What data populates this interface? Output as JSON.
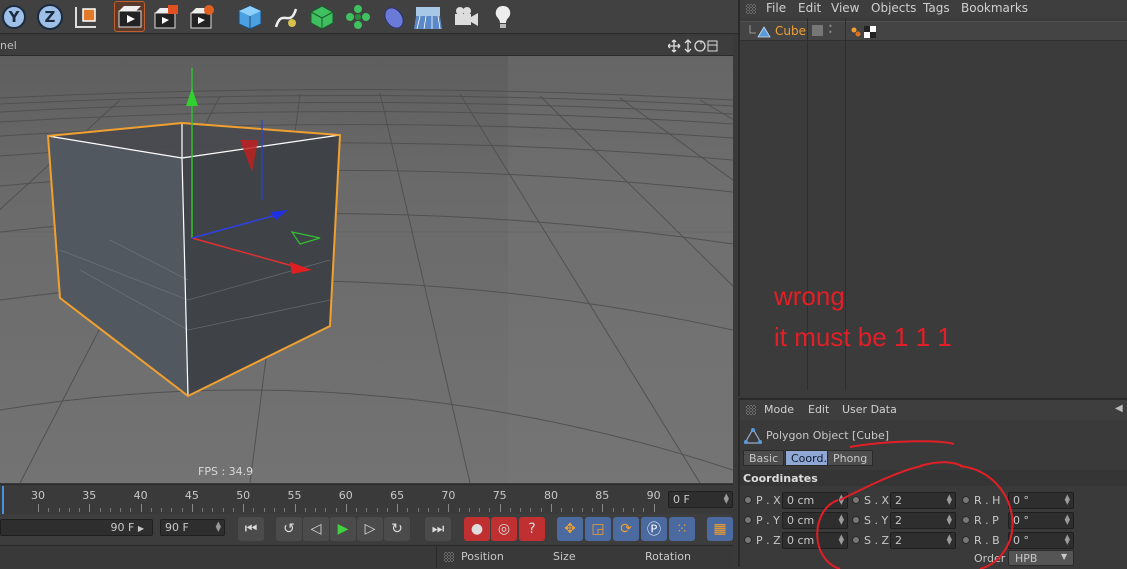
{
  "viewport": {
    "panel_title": "nel",
    "fps_label": "FPS : 34.9"
  },
  "timeline": {
    "ticks": [
      "30",
      "35",
      "40",
      "45",
      "50",
      "55",
      "60",
      "65",
      "70",
      "75",
      "80",
      "85",
      "90"
    ],
    "current_frame": "0 F",
    "min_frame_field": "90 F",
    "max_frame_field": "90 F"
  },
  "coord_header": {
    "position": "Position",
    "size": "Size",
    "rotation": "Rotation"
  },
  "object_manager": {
    "menu": [
      "File",
      "Edit",
      "View",
      "Objects",
      "Tags",
      "Bookmarks"
    ],
    "object_name": "Cube",
    "annotation_line1": "wrong",
    "annotation_line2": "it must be 1 1 1"
  },
  "attribute_manager": {
    "menu": [
      "Mode",
      "Edit",
      "User Data"
    ],
    "object_title": "Polygon Object [Cube]",
    "tabs": [
      "Basic",
      "Coord.",
      "Phong"
    ],
    "active_tab": "Coord.",
    "section": "Coordinates",
    "rows": [
      {
        "p_label": "P . X",
        "p_val": "0 cm",
        "s_label": "S . X",
        "s_val": "2",
        "r_label": "R . H",
        "r_val": "0 °"
      },
      {
        "p_label": "P . Y",
        "p_val": "0 cm",
        "s_label": "S . Y",
        "s_val": "2",
        "r_label": "R . P",
        "r_val": "0 °"
      },
      {
        "p_label": "P . Z",
        "p_val": "0 cm",
        "s_label": "S . Z",
        "s_val": "2",
        "r_label": "R . B",
        "r_val": "0 °"
      }
    ],
    "order_label": "Order",
    "order_value": "HPB"
  },
  "colors": {
    "annotation": "#e21f26",
    "selection_orange": "#f0a030",
    "active_tab_blue": "#8fa9d4"
  }
}
